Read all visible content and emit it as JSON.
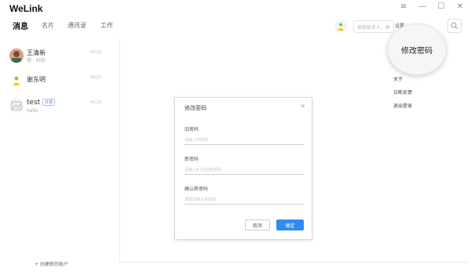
{
  "app": {
    "title": "WeLink"
  },
  "window_controls": [
    "≡",
    "—",
    "☐",
    "✕"
  ],
  "tabs": [
    {
      "label": "消息",
      "active": true
    },
    {
      "label": "名片",
      "active": false
    },
    {
      "label": "通讯录",
      "active": false
    },
    {
      "label": "工作",
      "active": false
    }
  ],
  "topbar": {
    "search_placeholder": "搜索联系人、群",
    "settings_label": "设置"
  },
  "conversations": [
    {
      "name": "王清新",
      "subtitle": "嗯 · 好的",
      "time": "09:22",
      "badge": ""
    },
    {
      "name": "谢东明",
      "subtitle": "",
      "time": "09:21",
      "badge": ""
    },
    {
      "name": "test",
      "subtitle": "hello",
      "time": "09:20",
      "badge": "外部"
    }
  ],
  "sidebar": {
    "add_account": "+ 创建新的账户"
  },
  "settings_menu": {
    "highlighted": "修改密码",
    "items": [
      "关于",
      "诊断反馈",
      "退出登录"
    ]
  },
  "dialog": {
    "title": "修改密码",
    "close": "✕",
    "fields": [
      {
        "label": "旧密码",
        "placeholder": "请输入旧密码"
      },
      {
        "label": "新密码",
        "placeholder": "请输入8-32位新密码"
      },
      {
        "label": "确认新密码",
        "placeholder": "请再次输入新密码"
      }
    ],
    "cancel": "取消",
    "ok": "确定"
  },
  "colors": {
    "primary": "#2d8cf0",
    "avatar_green": "#7ac943",
    "avatar_yellow": "#f5c400"
  }
}
